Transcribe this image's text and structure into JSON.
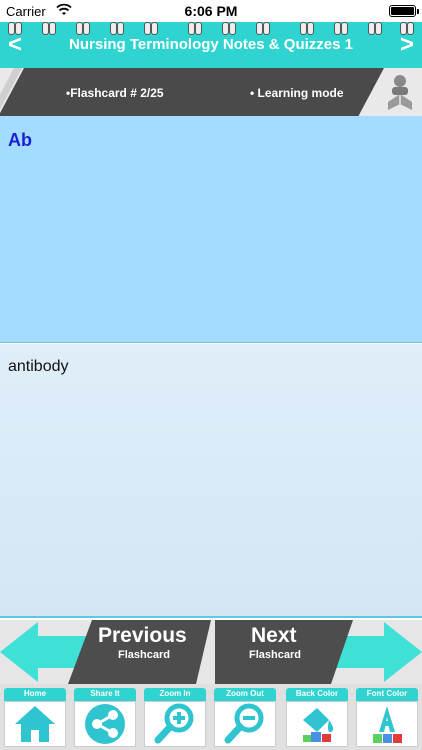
{
  "status": {
    "carrier": "Carrier",
    "time": "6:06 PM"
  },
  "nav": {
    "back_glyph": "<",
    "forward_glyph": ">",
    "title": "Nursing Terminology Notes & Quizzes 1"
  },
  "info": {
    "flashcard_label": "•Flashcard #  2/25",
    "mode_label": "• Learning mode"
  },
  "card": {
    "term": "Ab",
    "definition": "antibody"
  },
  "navigation_buttons": {
    "previous_title": "Previous",
    "previous_subtitle": "Flashcard",
    "next_title": "Next",
    "next_subtitle": "Flashcard"
  },
  "toolbar": {
    "items": [
      {
        "label": "Home",
        "icon": "home-icon"
      },
      {
        "label": "Share It",
        "icon": "share-icon"
      },
      {
        "label": "Zoom In",
        "icon": "zoom-in-icon"
      },
      {
        "label": "Zoom Out",
        "icon": "zoom-out-icon"
      },
      {
        "label": "Back Color",
        "icon": "back-color-icon"
      },
      {
        "label": "Font Color",
        "icon": "font-color-icon"
      }
    ]
  },
  "colors": {
    "accent": "#2fd3cf",
    "front_panel": "#a4dcff",
    "term_text": "#1a1fd6",
    "dark_strip": "#4a4a4a"
  }
}
